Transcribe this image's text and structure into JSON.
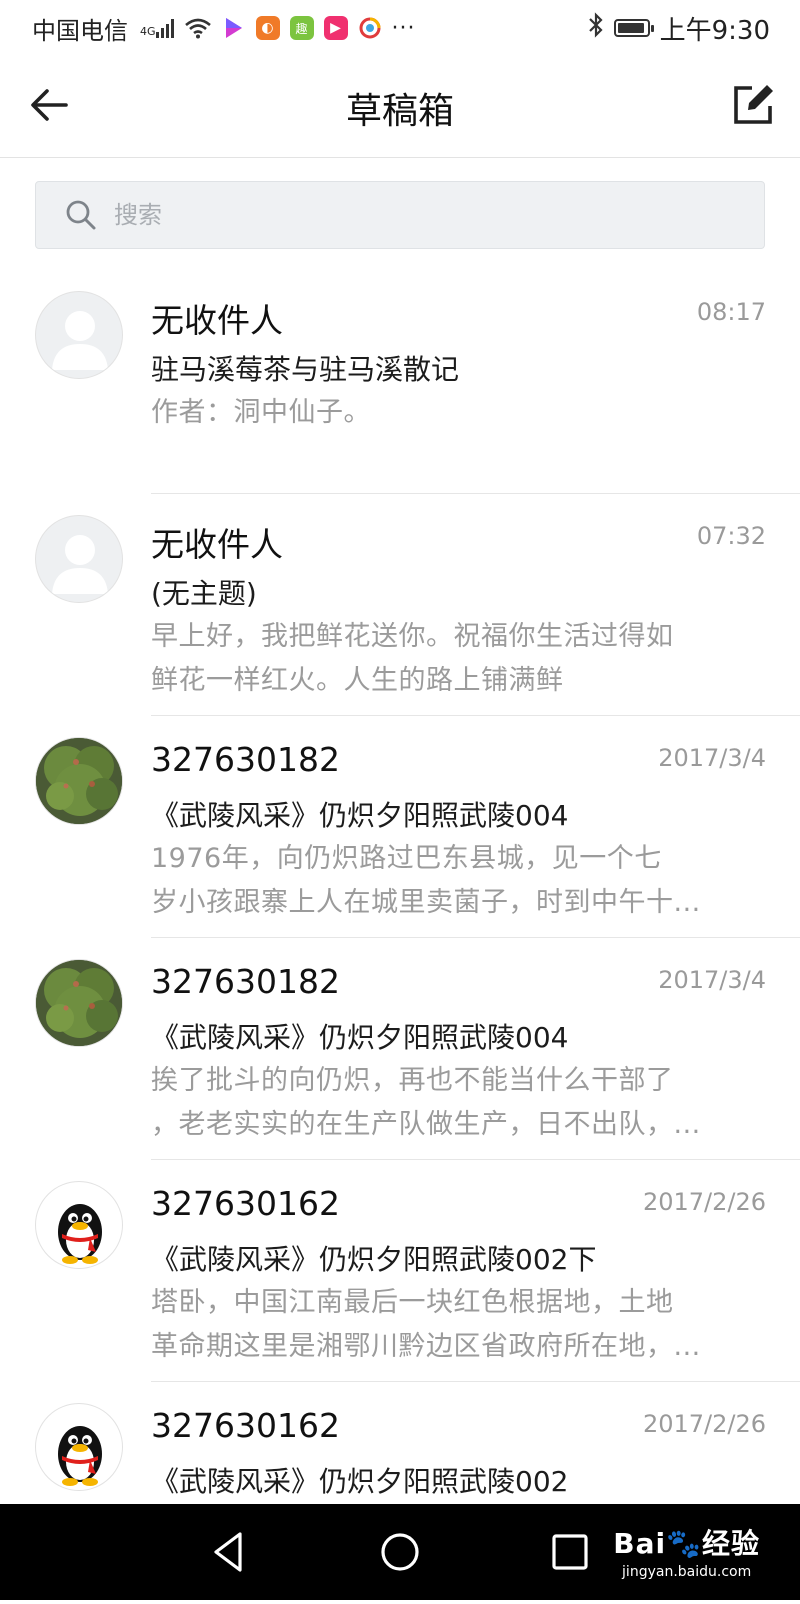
{
  "status_bar": {
    "carrier": "中国电信",
    "network": "4G",
    "time": "上午9:30",
    "battery_level": 0.85,
    "app_icons": [
      "video-app-icon",
      "uc-browser-icon",
      "qu-app-icon",
      "camera-app-icon",
      "weibo-app-icon"
    ],
    "more": "···"
  },
  "header": {
    "title": "草稿箱",
    "back_icon": "arrow-left-icon",
    "compose_icon": "compose-icon"
  },
  "search": {
    "placeholder": "搜索",
    "icon": "search-icon"
  },
  "drafts": [
    {
      "avatar": "default-person-avatar",
      "sender": "无收件人",
      "time": "08:17",
      "subject": "驻马溪莓茶与驻马溪散记",
      "preview_line1": "作者：洞中仙子。",
      "preview_line2": ""
    },
    {
      "avatar": "default-person-avatar",
      "sender": "无收件人",
      "time": "07:32",
      "subject": "(无主题)",
      "preview_line1": "早上好，我把鲜花送你。祝福你生活过得如",
      "preview_line2": "鲜花一样红火。人生的路上铺满鲜"
    },
    {
      "avatar": "tree-photo-avatar",
      "sender": "327630182",
      "time": "2017/3/4",
      "subject": "《武陵风采》仍炽夕阳照武陵004",
      "preview_line1": "1976年，向仍炽路过巴东县城，见一个七",
      "preview_line2": "岁小孩跟寨上人在城里卖菌子，时到中午十..."
    },
    {
      "avatar": "tree-photo-avatar",
      "sender": "327630182",
      "time": "2017/3/4",
      "subject": "《武陵风采》仍炽夕阳照武陵004",
      "preview_line1": "挨了批斗的向仍炽，再也不能当什么干部了",
      "preview_line2": "，老老实实的在生产队做生产，日不出队，..."
    },
    {
      "avatar": "qq-penguin-avatar",
      "sender": "327630162",
      "time": "2017/2/26",
      "subject": "《武陵风采》仍炽夕阳照武陵002下",
      "preview_line1": "塔卧，中国江南最后一块红色根据地，土地",
      "preview_line2": "革命期这里是湘鄂川黔边区省政府所在地，..."
    },
    {
      "avatar": "qq-penguin-avatar",
      "sender": "327630162",
      "time": "2017/2/26",
      "subject": "《武陵风采》仍炽夕阳照武陵002",
      "preview_line1": "",
      "preview_line2": ""
    }
  ],
  "nav_bar": {
    "back": "triangle-back-icon",
    "home": "circle-home-icon",
    "recents": "square-recents-icon"
  },
  "watermark": {
    "main": "Bai🐾经验",
    "sub": "jingyan.baidu.com"
  }
}
